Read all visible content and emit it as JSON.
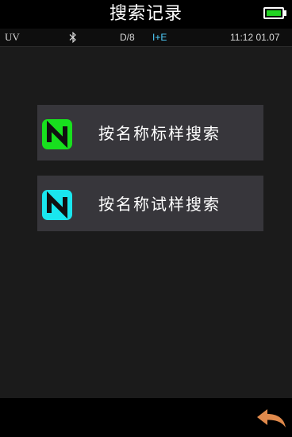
{
  "header": {
    "title": "搜索记录",
    "battery": {
      "icon": "battery-icon",
      "level": 1.0,
      "color": "#22d422"
    }
  },
  "status": {
    "light_mode": "UV",
    "bluetooth_icon": "bluetooth-icon",
    "geometry": "D/8",
    "specular_mode": "I+E",
    "datetime": "11:12 01.07"
  },
  "menu": {
    "items": [
      {
        "label": "按名称标样搜索",
        "icon": "standard-icon",
        "color": "#18e01e"
      },
      {
        "label": "按名称试样搜索",
        "icon": "sample-icon",
        "color": "#1ae6ee"
      }
    ]
  },
  "footer": {
    "back_icon": "back-arrow-icon",
    "back_color": "#e08a4c"
  }
}
